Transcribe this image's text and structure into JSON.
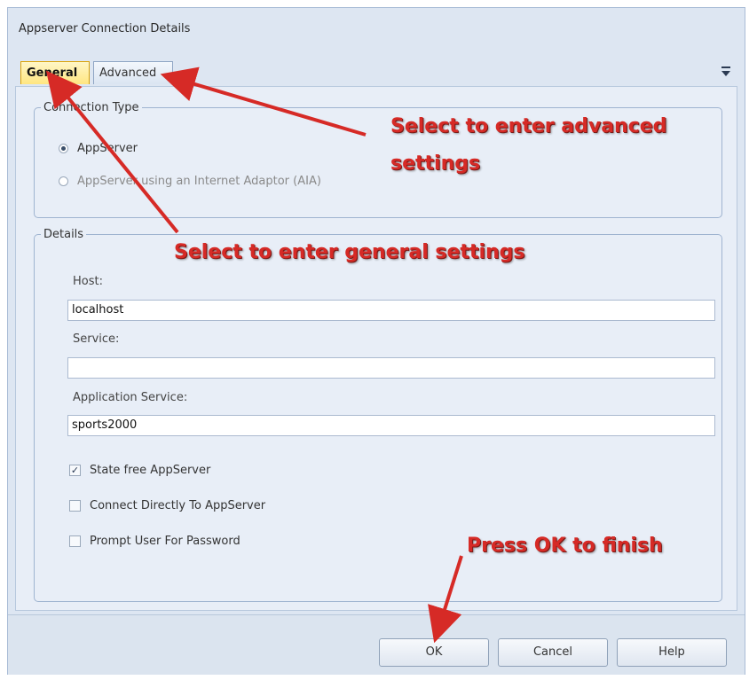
{
  "window": {
    "title": "Appserver Connection Details"
  },
  "tabs": [
    {
      "label": "General",
      "active": true
    },
    {
      "label": "Advanced",
      "active": false
    }
  ],
  "connection_type": {
    "legend": "Connection Type",
    "options": [
      {
        "label": "AppServer",
        "selected": true
      },
      {
        "label": "AppServer using an Internet Adaptor (AIA)",
        "selected": false
      }
    ]
  },
  "details": {
    "legend": "Details",
    "host_label": "Host:",
    "host_value": "localhost",
    "service_label": "Service:",
    "service_value": "",
    "app_service_label": "Application Service:",
    "app_service_value": "sports2000",
    "checkboxes": [
      {
        "label": "State free AppServer",
        "checked": true
      },
      {
        "label": "Connect Directly To AppServer",
        "checked": false
      },
      {
        "label": "Prompt User For Password",
        "checked": false
      }
    ]
  },
  "buttons": {
    "ok": "OK",
    "cancel": "Cancel",
    "help": "Help"
  },
  "annotations": {
    "advanced_line1": "Select to enter advanced",
    "advanced_line2": "settings",
    "general": "Select to enter general settings",
    "ok": "Press OK to finish"
  },
  "colors": {
    "annotation": "#d62a26",
    "active_tab": "#ffe681",
    "panel": "#e8eef7"
  },
  "icons": {
    "menu": "dropdown-menu-icon",
    "check": "checkmark-icon"
  }
}
